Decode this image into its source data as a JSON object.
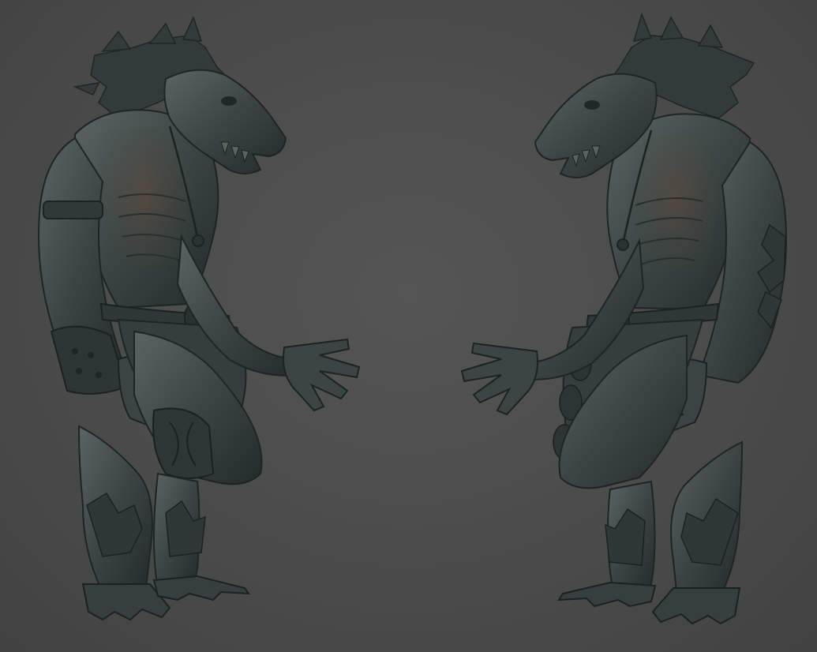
{
  "scene": {
    "background_color": "#4a4a4a",
    "clay_color": "#3b4544",
    "clay_highlight": "#5f6a68",
    "clay_shadow": "#222a29",
    "subject": "werewolf-sculpt",
    "views": [
      {
        "name": "side-view-facing-right"
      },
      {
        "name": "side-view-facing-left"
      }
    ]
  }
}
